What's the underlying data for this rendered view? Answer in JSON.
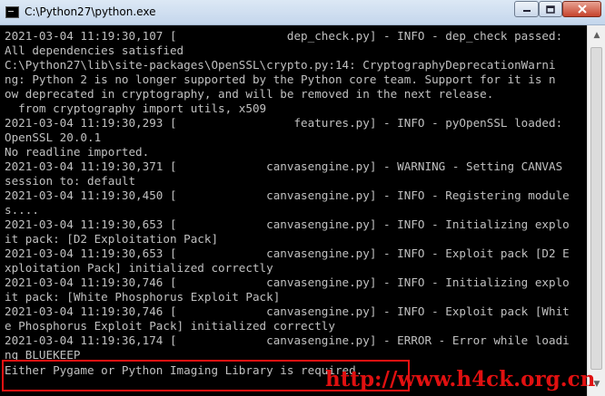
{
  "window": {
    "title": "C:\\Python27\\python.exe",
    "controls": {
      "minimize_icon": "minimize-icon",
      "maximize_icon": "maximize-icon",
      "close_icon": "close-icon"
    }
  },
  "console": {
    "lines": [
      "2021-03-04 11:19:30,107 [                dep_check.py] - INFO - dep_check passed:",
      "All dependencies satisfied",
      "C:\\Python27\\lib\\site-packages\\OpenSSL\\crypto.py:14: CryptographyDeprecationWarni",
      "ng: Python 2 is no longer supported by the Python core team. Support for it is n",
      "ow deprecated in cryptography, and will be removed in the next release.",
      "  from cryptography import utils, x509",
      "2021-03-04 11:19:30,293 [                 features.py] - INFO - pyOpenSSL loaded:",
      "OpenSSL 20.0.1",
      "No readline imported.",
      "2021-03-04 11:19:30,371 [             canvasengine.py] - WARNING - Setting CANVAS",
      "session to: default",
      "2021-03-04 11:19:30,450 [             canvasengine.py] - INFO - Registering module",
      "s....",
      "2021-03-04 11:19:30,653 [             canvasengine.py] - INFO - Initializing explo",
      "it pack: [D2 Exploitation Pack]",
      "2021-03-04 11:19:30,653 [             canvasengine.py] - INFO - Exploit pack [D2 E",
      "xploitation Pack] initialized correctly",
      "2021-03-04 11:19:30,746 [             canvasengine.py] - INFO - Initializing explo",
      "it pack: [White Phosphorus Exploit Pack]",
      "2021-03-04 11:19:30,746 [             canvasengine.py] - INFO - Exploit pack [Whit",
      "e Phosphorus Exploit Pack] initialized correctly",
      "2021-03-04 11:19:36,174 [             canvasengine.py] - ERROR - Error while loadi",
      "ng BLUEKEEP",
      "Either Pygame or Python Imaging Library is required."
    ]
  },
  "watermark": "http://www.h4ck.org.cn",
  "scrollbar": {
    "up_icon": "scroll-up-arrow-icon",
    "down_icon": "scroll-down-arrow-icon"
  },
  "colors": {
    "console_bg": "#000000",
    "console_fg": "#c0c0c0",
    "highlight": "#ee1111",
    "watermark": "#e01010"
  }
}
